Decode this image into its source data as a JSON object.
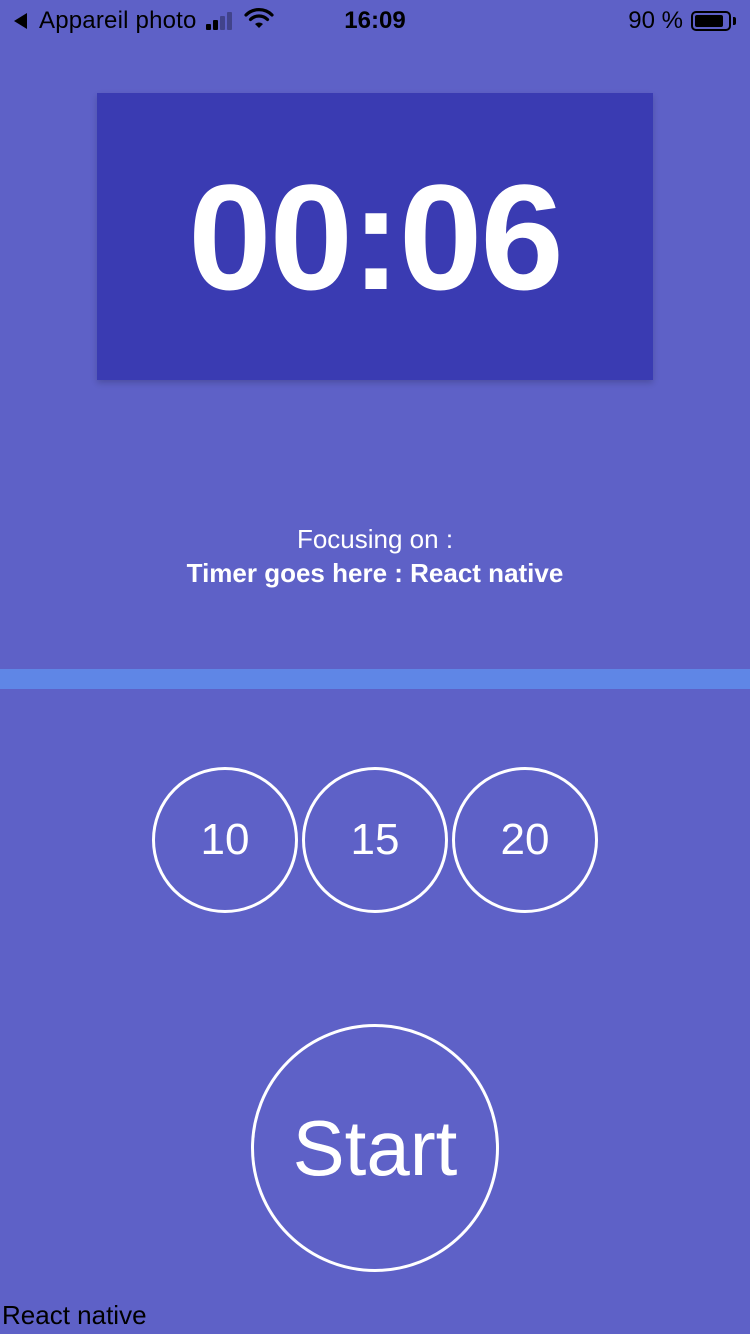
{
  "status_bar": {
    "carrier": "Appareil photo",
    "time": "16:09",
    "battery": "90 %",
    "battery_level": 0.9,
    "icons": [
      "back-arrow-icon",
      "signal-icon",
      "wifi-icon",
      "battery-icon"
    ]
  },
  "timer": {
    "display": "00:06"
  },
  "focus": {
    "title": "Focusing on :",
    "subject": "Timer goes here : React native"
  },
  "progress": {
    "fraction": 1.0
  },
  "durations": {
    "options": [
      "10",
      "15",
      "20"
    ]
  },
  "start_button": {
    "label": "Start"
  },
  "footer": {
    "label": "React native"
  },
  "colors": {
    "background": "#5e61c7",
    "timer_card": "#3a3bb2",
    "progress": "#5f86e6",
    "text": "#ffffff"
  }
}
